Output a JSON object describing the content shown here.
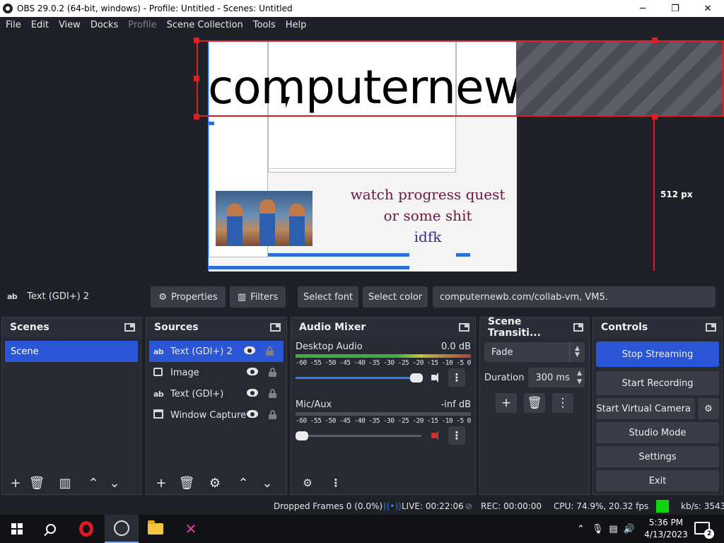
{
  "window": {
    "title": "OBS 29.0.2 (64-bit, windows) - Profile: Untitled - Scenes: Untitled",
    "min": "─",
    "max": "❐",
    "close": "✕"
  },
  "menu": [
    "File",
    "Edit",
    "View",
    "Docks",
    "Profile",
    "Scene Collection",
    "Tools",
    "Help"
  ],
  "preview": {
    "big_text": "computernew",
    "overlay_line1": "watch progress quest",
    "overlay_line2": "or some shit",
    "overlay_line3": "idfk",
    "dimension_label": "512 px"
  },
  "source_toolbar": {
    "selected_source": "Text (GDI+) 2",
    "source_icon": "ab",
    "properties": "Properties",
    "filters": "Filters",
    "select_font": "Select font",
    "select_color": "Select color",
    "text_value": "computernewb.com/collab-vm, VM5."
  },
  "scenes": {
    "title": "Scenes",
    "items": [
      "Scene"
    ]
  },
  "sources": {
    "title": "Sources",
    "items": [
      {
        "label": "Text (GDI+) 2",
        "icon": "ab",
        "selected": true
      },
      {
        "label": "Image",
        "icon": "image-icon",
        "selected": false
      },
      {
        "label": "Text (GDI+)",
        "icon": "ab",
        "selected": false
      },
      {
        "label": "Window Capture",
        "icon": "window-icon",
        "selected": false
      }
    ]
  },
  "audio_mixer": {
    "title": "Audio Mixer",
    "channels": [
      {
        "name": "Desktop Audio",
        "level": "0.0 dB",
        "volume": 0.97,
        "muted": false
      },
      {
        "name": "Mic/Aux",
        "level": "-inf dB",
        "volume": 0.0,
        "muted": true
      }
    ],
    "scale": [
      "-60",
      "-55",
      "-50",
      "-45",
      "-40",
      "-35",
      "-30",
      "-25",
      "-20",
      "-15",
      "-10",
      "-5",
      "0"
    ]
  },
  "transitions": {
    "title": "Scene Transiti...",
    "selected": "Fade",
    "duration_label": "Duration",
    "duration_value": "300 ms"
  },
  "controls": {
    "title": "Controls",
    "stop_streaming": "Stop Streaming",
    "start_recording": "Start Recording",
    "start_virtual_camera": "Start Virtual Camera",
    "studio_mode": "Studio Mode",
    "settings": "Settings",
    "exit": "Exit"
  },
  "status": {
    "dropped_frames": "Dropped Frames 0 (0.0%)",
    "live": "LIVE: 00:22:06",
    "rec": "REC: 00:00:00",
    "cpu": "CPU: 74.9%, 20.32 fps",
    "kbps": "kb/s: 3543",
    "health_color": "#0fd60f"
  },
  "taskbar": {
    "time": "5:36 PM",
    "date": "4/13/2023",
    "notifications": "2"
  },
  "colors": {
    "accent": "#2a56d6",
    "selection": "#e02020"
  }
}
